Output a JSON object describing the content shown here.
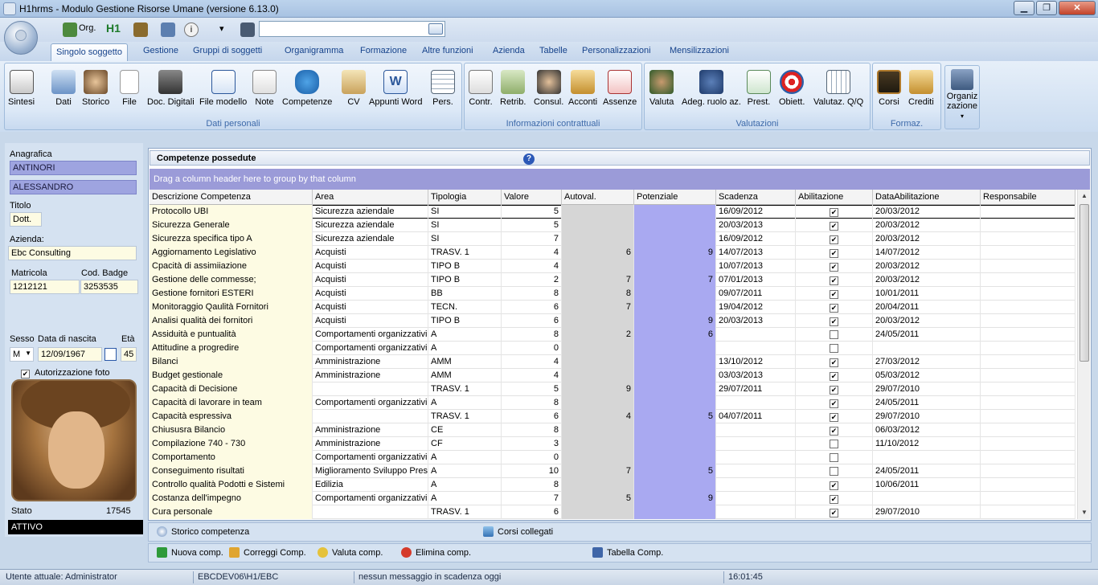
{
  "window": {
    "title": "H1hrms - Modulo Gestione Risorse Umane (versione 6.13.0)",
    "minimize": "▁",
    "maximize": "❐",
    "close": "✕"
  },
  "qat": {
    "org_label": "Org.",
    "h1_label": "H1",
    "more": "▾",
    "search_value": ""
  },
  "tabs": [
    "Singolo soggetto",
    "Gestione",
    "Gruppi di soggetti",
    "Organigramma",
    "Formazione",
    "Altre funzioni",
    "Azienda",
    "Tabelle",
    "Personalizzazioni",
    "Mensilizzazioni"
  ],
  "ribbon": {
    "group1": {
      "title": "Dati personali",
      "buttons": [
        "Sintesi",
        "Dati",
        "Storico",
        "File",
        "Doc. Digitali",
        "File modello",
        "Note",
        "Competenze",
        "CV",
        "Appunti Word",
        "Pers."
      ]
    },
    "group2": {
      "title": "Informazioni contrattuali",
      "buttons": [
        "Contr.",
        "Retrib.",
        "Consul.",
        "Acconti",
        "Assenze"
      ]
    },
    "group3": {
      "title": "Valutazioni",
      "buttons": [
        "Valuta",
        "Adeg. ruolo az.",
        "Prest.",
        "Obiett.",
        "Valutaz. Q/Q"
      ]
    },
    "group4": {
      "title": "Formaz.",
      "buttons": [
        "Corsi",
        "Crediti"
      ]
    },
    "org": {
      "label1": "Organiz",
      "label2": "zazione",
      "more": "▾"
    }
  },
  "left": {
    "anagrafica_label": "Anagrafica",
    "cognome": "ANTINORI",
    "nome": "ALESSANDRO",
    "titolo_label": "Titolo",
    "titolo": "Dott.",
    "azienda_label": "Azienda:",
    "azienda": "Ebc Consulting",
    "matricola_label": "Matricola",
    "matricola": "1212121",
    "badge_label": "Cod. Badge",
    "badge": "3253535",
    "sesso_label": "Sesso",
    "sesso": "M",
    "nascita_label": "Data di nascita",
    "nascita": "12/09/1967",
    "eta_label": "Età",
    "eta": "45",
    "autorizzazione": "Autorizzazione foto",
    "stato_label": "Stato",
    "stato_code": "17545",
    "stato": "ATTIVO"
  },
  "grid": {
    "title": "Competenze possedute",
    "group_hint": "Drag a column header here to group by that column",
    "columns": [
      "Descrizione Competenza",
      "Area",
      "Tipologia",
      "Valore",
      "Autoval.",
      "Potenziale",
      "Scadenza",
      "Abilitazione",
      "DataAbilitazione",
      "Responsabile"
    ],
    "rows": [
      [
        "Protocollo UBI",
        "Sicurezza aziendale",
        "SI",
        "5",
        "",
        "",
        "16/09/2012",
        true,
        "20/03/2012",
        ""
      ],
      [
        "Sicurezza Generale",
        "Sicurezza aziendale",
        "SI",
        "5",
        "",
        "",
        "20/03/2013",
        true,
        "20/03/2012",
        ""
      ],
      [
        "Sicurezza specifica tipo A",
        "Sicurezza aziendale",
        "SI",
        "7",
        "",
        "",
        "16/09/2012",
        true,
        "20/03/2012",
        ""
      ],
      [
        " Aggiornamento Legislativo",
        "Acquisti",
        "TRASV. 1",
        "4",
        "6",
        "9",
        "14/07/2013",
        true,
        "14/07/2012",
        ""
      ],
      [
        " Cpacità di assimiiazione",
        "Acquisti",
        "TIPO B",
        "4",
        "",
        "",
        "10/07/2013",
        true,
        "20/03/2012",
        ""
      ],
      [
        " Gestione delle commesse;",
        "Acquisti",
        "TIPO B",
        "2",
        "7",
        "7",
        "07/01/2013",
        true,
        "20/03/2012",
        ""
      ],
      [
        " Gestione fornitori ESTERI",
        "Acquisti",
        "BB",
        "8",
        "8",
        "",
        "09/07/2011",
        true,
        "10/01/2011",
        ""
      ],
      [
        " Monitoraggio Qaulità Fornitori",
        "Acquisti",
        "TECN.",
        "6",
        "7",
        "",
        "19/04/2012",
        true,
        "20/04/2011",
        ""
      ],
      [
        "Analisi qualità dei fornitori",
        "Acquisti",
        "TIPO B",
        "6",
        "",
        "9",
        "20/03/2013",
        true,
        "20/03/2012",
        ""
      ],
      [
        "Assiduità e puntualità",
        "Comportamenti organizzativi",
        "A",
        "8",
        "2",
        "6",
        "",
        false,
        "24/05/2011",
        ""
      ],
      [
        "Attitudine a progredire",
        "Comportamenti organizzativi",
        "A",
        "0",
        "",
        "",
        "",
        false,
        "",
        ""
      ],
      [
        "Bilanci",
        "Amministrazione",
        "AMM",
        "4",
        "",
        "",
        "13/10/2012",
        true,
        "27/03/2012",
        ""
      ],
      [
        "Budget gestionale",
        "Amministrazione",
        "AMM",
        "4",
        "",
        "",
        "03/03/2013",
        true,
        "05/03/2012",
        ""
      ],
      [
        "Capacità di Decisione",
        "",
        "TRASV. 1",
        "5",
        "9",
        "",
        "29/07/2011",
        true,
        "29/07/2010",
        ""
      ],
      [
        "Capacità di lavorare in team",
        "Comportamenti organizzativi",
        "A",
        "8",
        "",
        "",
        "",
        true,
        "24/05/2011",
        ""
      ],
      [
        "Capacità espressiva",
        "",
        "TRASV. 1",
        "6",
        "4",
        "5",
        "04/07/2011",
        true,
        "29/07/2010",
        ""
      ],
      [
        "Chiususra Bilancio",
        "Amministrazione",
        "CE",
        "8",
        "",
        "",
        "",
        true,
        "06/03/2012",
        ""
      ],
      [
        "Compilazione 740 - 730",
        "Amministrazione",
        "CF",
        "3",
        "",
        "",
        "",
        false,
        "11/10/2012",
        ""
      ],
      [
        "Comportamento",
        "Comportamenti organizzativi",
        "A",
        "0",
        "",
        "",
        "",
        false,
        "",
        ""
      ],
      [
        "Conseguimento risultati",
        "Miglioramento Sviluppo Presta",
        "A",
        "10",
        "7",
        "5",
        "",
        false,
        "24/05/2011",
        ""
      ],
      [
        "Controllo qualità Podotti e Sistemi",
        "Edilizia",
        "A",
        "8",
        "",
        "",
        "",
        true,
        "10/06/2011",
        ""
      ],
      [
        "Costanza dell'impegno",
        "Comportamenti organizzativi",
        "A",
        "7",
        "5",
        "9",
        "",
        true,
        "",
        ""
      ],
      [
        "Cura personale",
        "",
        "TRASV. 1",
        "6",
        "",
        "",
        "",
        true,
        "29/07/2010",
        ""
      ]
    ]
  },
  "bottom1": {
    "storico": "Storico competenza",
    "corsi": "Corsi collegati"
  },
  "bottom2": {
    "nuova": "Nuova comp.",
    "correggi": "Correggi Comp.",
    "valuta": "Valuta comp.",
    "elimina": "Elimina comp.",
    "tabella": "Tabella Comp."
  },
  "statusbar": {
    "user": "Utente attuale: Administrator",
    "db": "EBCDEV06\\H1/EBC",
    "msg": "nessun messaggio in scadenza oggi",
    "time": "16:01:45"
  },
  "colors": {
    "accent": "#15428b",
    "highlight": "#9b9bd8",
    "potenziale": "#a9a9f1",
    "autoval": "#d6d6d6",
    "desc_bg": "#fdfbe3"
  }
}
